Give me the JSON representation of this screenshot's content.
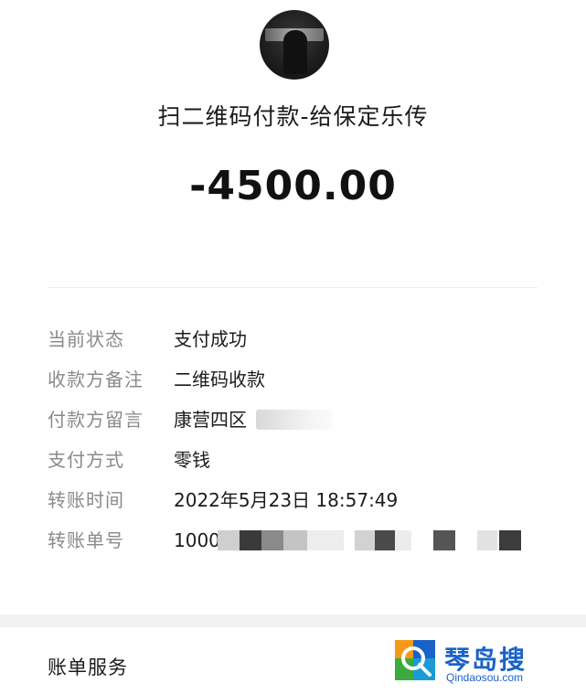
{
  "header": {
    "title": "扫二维码付款-给保定乐传",
    "amount": "-4500.00"
  },
  "details": [
    {
      "label": "当前状态",
      "value": "支付成功"
    },
    {
      "label": "收款方备注",
      "value": "二维码收款"
    },
    {
      "label": "付款方留言",
      "value": "康营四区"
    },
    {
      "label": "支付方式",
      "value": "零钱"
    },
    {
      "label": "转账时间",
      "value": "2022年5月23日 18:57:49"
    },
    {
      "label": "转账单号",
      "value": "1000"
    }
  ],
  "footer": {
    "bill_service_label": "账单服务"
  },
  "watermark": {
    "title": "琴岛搜",
    "subtitle": "Qindaosou.com"
  },
  "colors": {
    "label_gray": "#8a8a8a",
    "text_dark": "#1c1c1c",
    "watermark_blue": "#1a62c7",
    "section_gap": "#f2f2f2"
  }
}
